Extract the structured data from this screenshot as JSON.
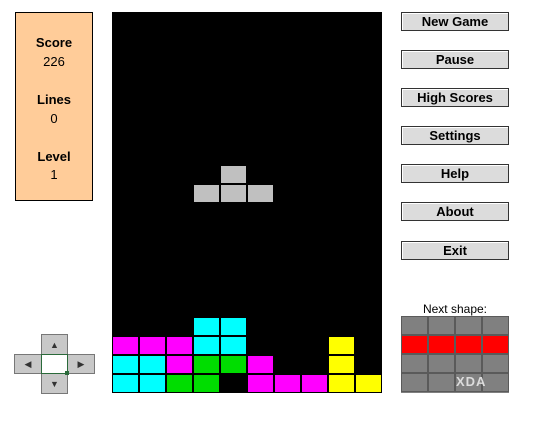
{
  "stats": {
    "score_label": "Score",
    "score": "226",
    "lines_label": "Lines",
    "lines": "0",
    "level_label": "Level",
    "level": "1"
  },
  "menu": {
    "new_game": "New Game",
    "pause": "Pause",
    "high_scores": "High Scores",
    "settings": "Settings",
    "help": "Help",
    "about": "About",
    "exit": "Exit"
  },
  "next": {
    "label": "Next shape:",
    "piece_color": "#ff0000",
    "empty_color": "#808080",
    "cells": [
      [
        0,
        0,
        0,
        0
      ],
      [
        1,
        1,
        1,
        1
      ],
      [
        0,
        0,
        0,
        0
      ],
      [
        0,
        0,
        0,
        0
      ]
    ]
  },
  "watermark": "XDA",
  "board": {
    "cols": 10,
    "rows": 20,
    "colors": {
      "G": "#c0c0c0",
      "C": "#00ffff",
      "M": "#ff00ff",
      "L": "#00dd00",
      "Y": "#ffff00"
    },
    "active_piece": [
      {
        "row": 8,
        "col": 4,
        "c": "G"
      },
      {
        "row": 9,
        "col": 3,
        "c": "G"
      },
      {
        "row": 9,
        "col": 4,
        "c": "G"
      },
      {
        "row": 9,
        "col": 5,
        "c": "G"
      }
    ],
    "stack": [
      {
        "row": 16,
        "col": 3,
        "c": "C"
      },
      {
        "row": 16,
        "col": 4,
        "c": "C"
      },
      {
        "row": 17,
        "col": 0,
        "c": "M"
      },
      {
        "row": 17,
        "col": 1,
        "c": "M"
      },
      {
        "row": 17,
        "col": 2,
        "c": "M"
      },
      {
        "row": 17,
        "col": 3,
        "c": "C"
      },
      {
        "row": 17,
        "col": 4,
        "c": "C"
      },
      {
        "row": 17,
        "col": 8,
        "c": "Y"
      },
      {
        "row": 18,
        "col": 0,
        "c": "C"
      },
      {
        "row": 18,
        "col": 1,
        "c": "C"
      },
      {
        "row": 18,
        "col": 2,
        "c": "M"
      },
      {
        "row": 18,
        "col": 3,
        "c": "L"
      },
      {
        "row": 18,
        "col": 4,
        "c": "L"
      },
      {
        "row": 18,
        "col": 5,
        "c": "M"
      },
      {
        "row": 18,
        "col": 8,
        "c": "Y"
      },
      {
        "row": 19,
        "col": 0,
        "c": "C"
      },
      {
        "row": 19,
        "col": 1,
        "c": "C"
      },
      {
        "row": 19,
        "col": 2,
        "c": "L"
      },
      {
        "row": 19,
        "col": 3,
        "c": "L"
      },
      {
        "row": 19,
        "col": 5,
        "c": "M"
      },
      {
        "row": 19,
        "col": 6,
        "c": "M"
      },
      {
        "row": 19,
        "col": 7,
        "c": "M"
      },
      {
        "row": 19,
        "col": 8,
        "c": "Y"
      },
      {
        "row": 19,
        "col": 9,
        "c": "Y"
      }
    ]
  },
  "dpad": {
    "up_icon": "arrow-up-icon",
    "down_icon": "arrow-down-icon",
    "left_icon": "arrow-left-icon",
    "right_icon": "arrow-right-icon"
  }
}
